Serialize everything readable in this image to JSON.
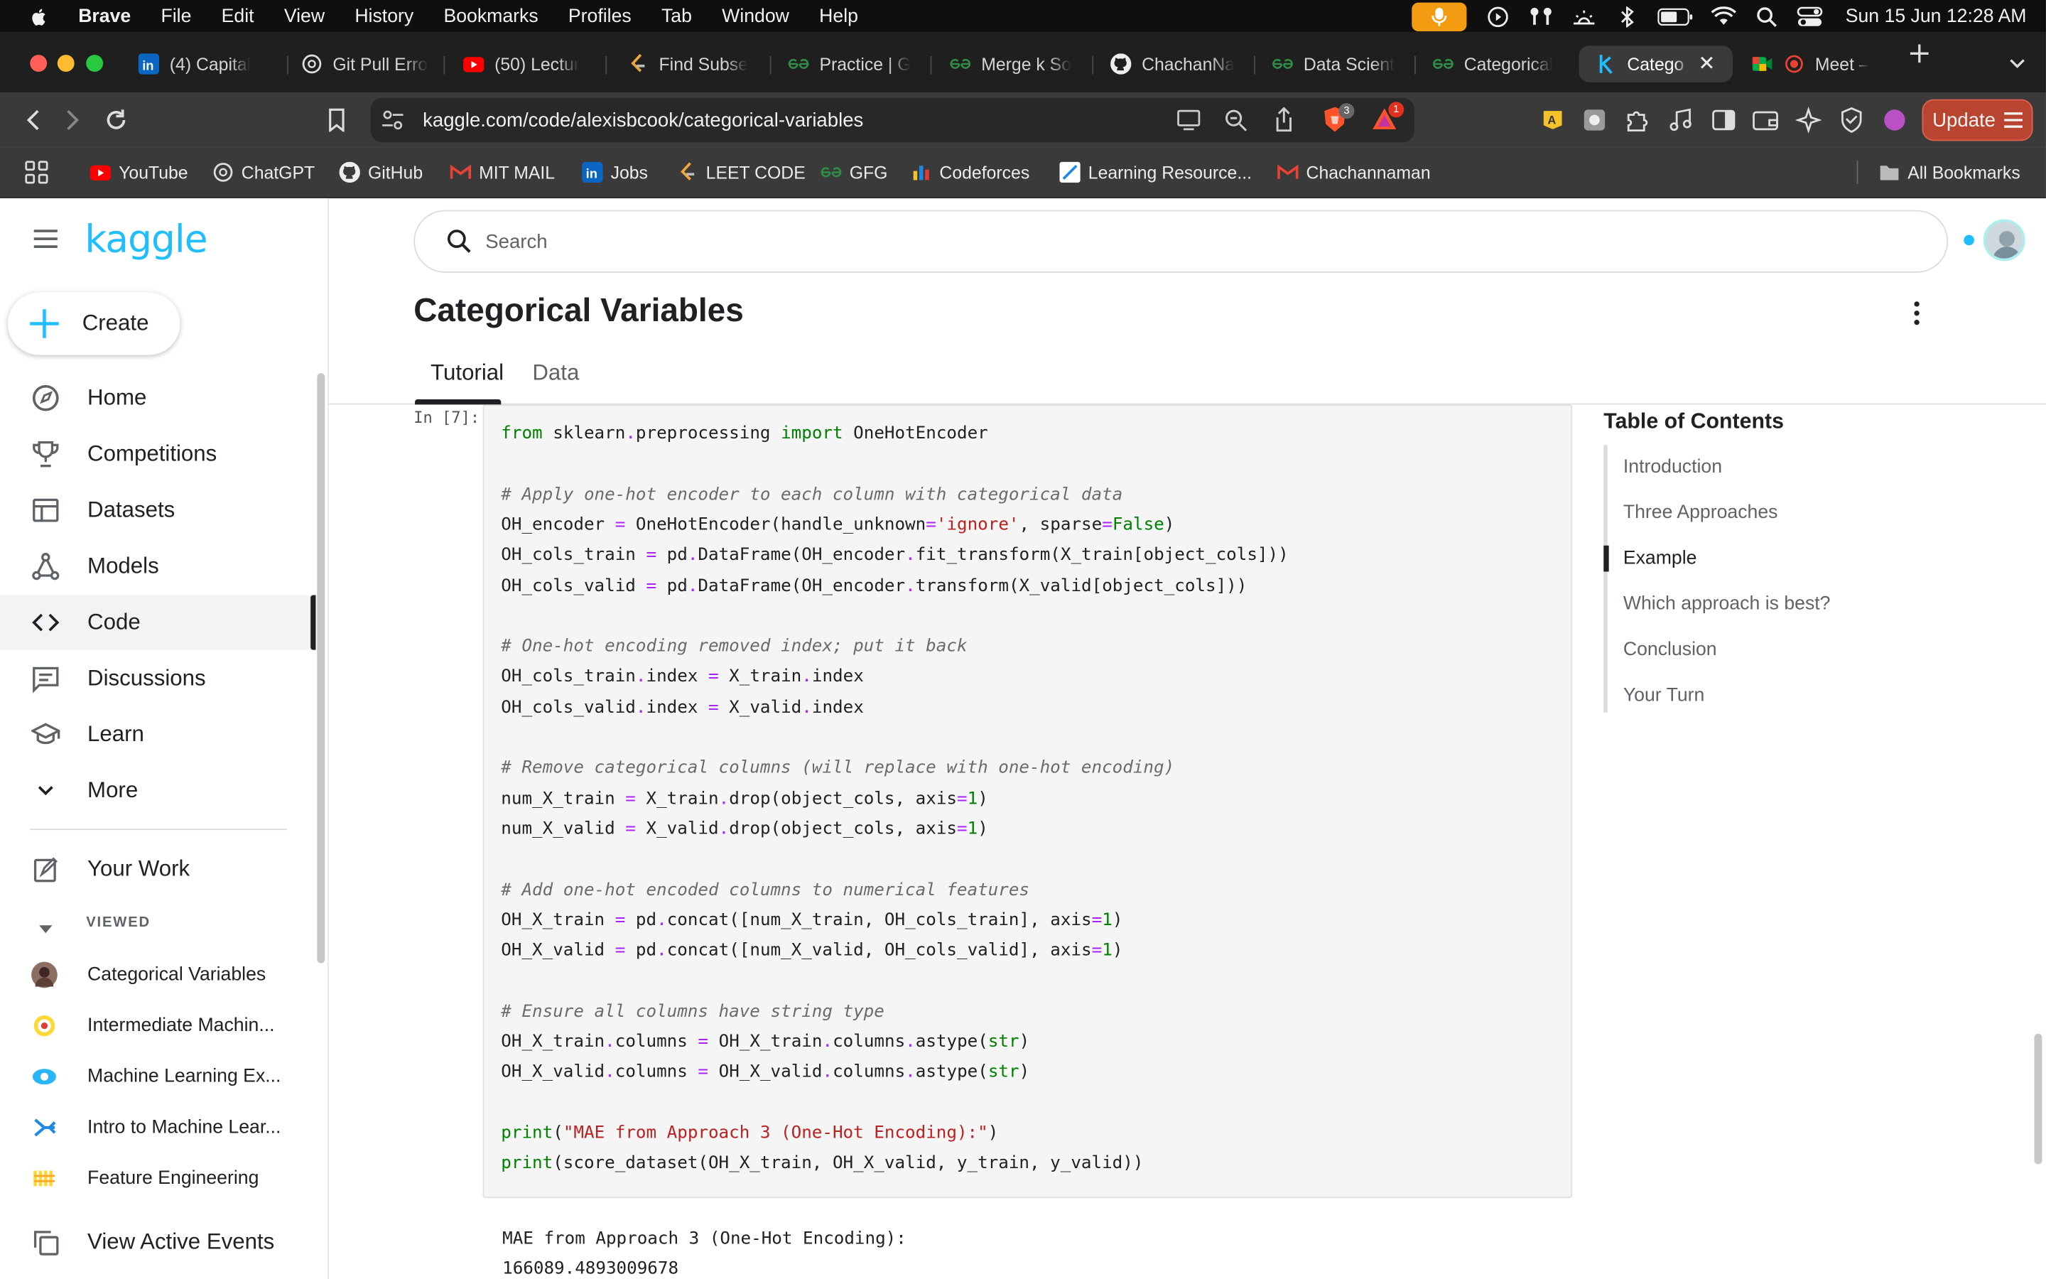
{
  "menubar": {
    "app": "Brave",
    "items": [
      "File",
      "Edit",
      "View",
      "History",
      "Bookmarks",
      "Profiles",
      "Tab",
      "Window",
      "Help"
    ],
    "clock": "Sun 15 Jun  12:28 AM"
  },
  "tabs": [
    {
      "label": "(4) Capital",
      "icon": "linkedin-icon"
    },
    {
      "label": "Git Pull Erro",
      "icon": "chatgpt-icon"
    },
    {
      "label": "(50) Lectur",
      "icon": "youtube-icon"
    },
    {
      "label": "Find Subse",
      "icon": "leetcode-icon"
    },
    {
      "label": "Practice | G",
      "icon": "gfg-icon"
    },
    {
      "label": "Merge k So",
      "icon": "gfg-icon"
    },
    {
      "label": "ChachanNa",
      "icon": "github-icon"
    },
    {
      "label": "Data Scient",
      "icon": "gfg-icon"
    },
    {
      "label": "Categorical",
      "icon": "gfg-icon"
    },
    {
      "label": "Catego",
      "icon": "kaggle-icon",
      "active": true
    },
    {
      "label": "Meet – ",
      "icon": "meet-icon"
    }
  ],
  "toolbar": {
    "url": "kaggle.com/code/alexisbcook/categorical-variables",
    "shield_count": "3",
    "alert_count": "1",
    "update_label": "Update"
  },
  "bookmarks": {
    "items": [
      "YouTube",
      "ChatGPT",
      "GitHub",
      "MIT MAIL",
      "Jobs",
      "LEET CODE",
      "GFG",
      "Codeforces",
      "Learning Resource...",
      "Chachannaman"
    ],
    "all_label": "All Bookmarks"
  },
  "kaggle": {
    "logo": "kaggle",
    "create_label": "Create",
    "nav": [
      "Home",
      "Competitions",
      "Datasets",
      "Models",
      "Code",
      "Discussions",
      "Learn",
      "More"
    ],
    "your_work": "Your Work",
    "viewed_header": "VIEWED",
    "viewed": [
      "Categorical Variables",
      "Intermediate Machin...",
      "Machine Learning Ex...",
      "Intro to Machine Lear...",
      "Feature Engineering"
    ],
    "active_events": "View Active Events",
    "search_placeholder": "Search",
    "page_title": "Categorical Variables",
    "page_tabs": [
      "Tutorial",
      "Data"
    ],
    "cell_prompt": "In [7]:",
    "output_lines": [
      "MAE from Approach 3 (One-Hot Encoding):",
      "166089.4893009678"
    ],
    "toc_title": "Table of Contents",
    "toc": [
      "Introduction",
      "Three Approaches",
      "Example",
      "Which approach is best?",
      "Conclusion",
      "Your Turn"
    ],
    "toc_active_index": 2
  },
  "code_lines": [
    "from sklearn.preprocessing import OneHotEncoder",
    "",
    "# Apply one-hot encoder to each column with categorical data",
    "OH_encoder = OneHotEncoder(handle_unknown='ignore', sparse=False)",
    "OH_cols_train = pd.DataFrame(OH_encoder.fit_transform(X_train[object_cols]))",
    "OH_cols_valid = pd.DataFrame(OH_encoder.transform(X_valid[object_cols]))",
    "",
    "# One-hot encoding removed index; put it back",
    "OH_cols_train.index = X_train.index",
    "OH_cols_valid.index = X_valid.index",
    "",
    "# Remove categorical columns (will replace with one-hot encoding)",
    "num_X_train = X_train.drop(object_cols, axis=1)",
    "num_X_valid = X_valid.drop(object_cols, axis=1)",
    "",
    "# Add one-hot encoded columns to numerical features",
    "OH_X_train = pd.concat([num_X_train, OH_cols_train], axis=1)",
    "OH_X_valid = pd.concat([num_X_valid, OH_cols_valid], axis=1)",
    "",
    "# Ensure all columns have string type",
    "OH_X_train.columns = OH_X_train.columns.astype(str)",
    "OH_X_valid.columns = OH_X_valid.columns.astype(str)",
    "",
    "print(\"MAE from Approach 3 (One-Hot Encoding):\")",
    "print(score_dataset(OH_X_train, OH_X_valid, y_train, y_valid))"
  ],
  "colors": {
    "kaggle_blue": "#20beff",
    "brave_orange": "#fb542b",
    "menubar_bg": "#0f0f0f"
  }
}
